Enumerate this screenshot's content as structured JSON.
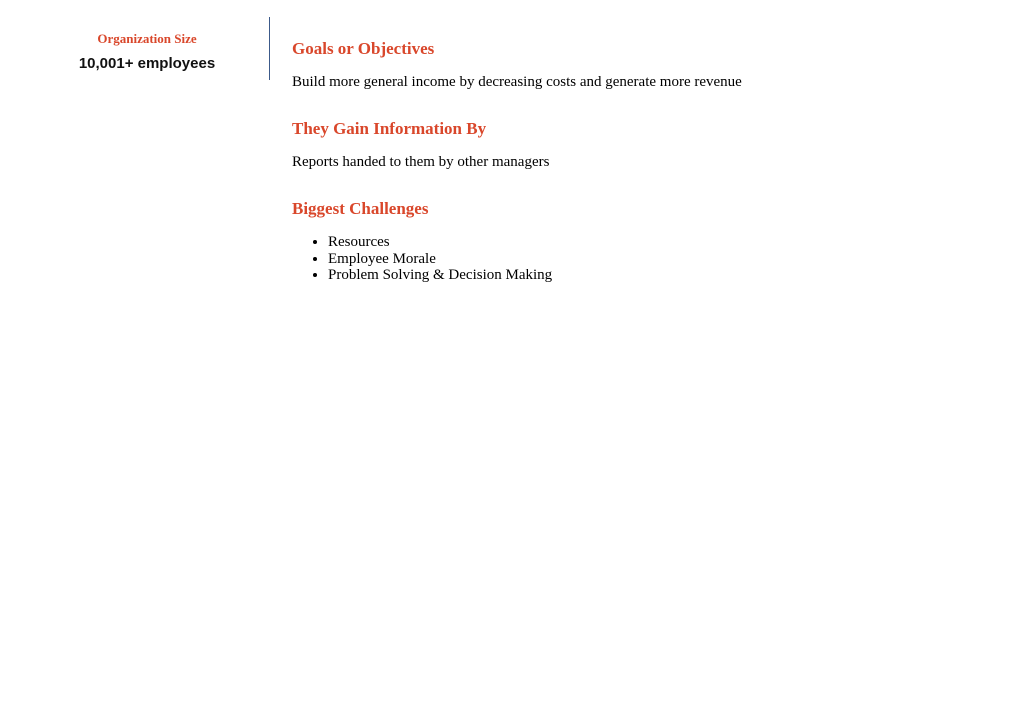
{
  "sidebar": {
    "label": "Organization Size",
    "value": "10,001+ employees"
  },
  "sections": {
    "goals": {
      "heading": "Goals or Objectives",
      "body": "Build more general income by decreasing costs and generate more revenue"
    },
    "information": {
      "heading": "They Gain Information By",
      "body": "Reports handed to them by other managers"
    },
    "challenges": {
      "heading": "Biggest Challenges",
      "items": [
        "Resources",
        "Employee Morale",
        "Problem Solving & Decision Making"
      ]
    }
  },
  "colors": {
    "heading": "#d9472b",
    "divider": "#3c5a8a",
    "text": "#000000"
  }
}
